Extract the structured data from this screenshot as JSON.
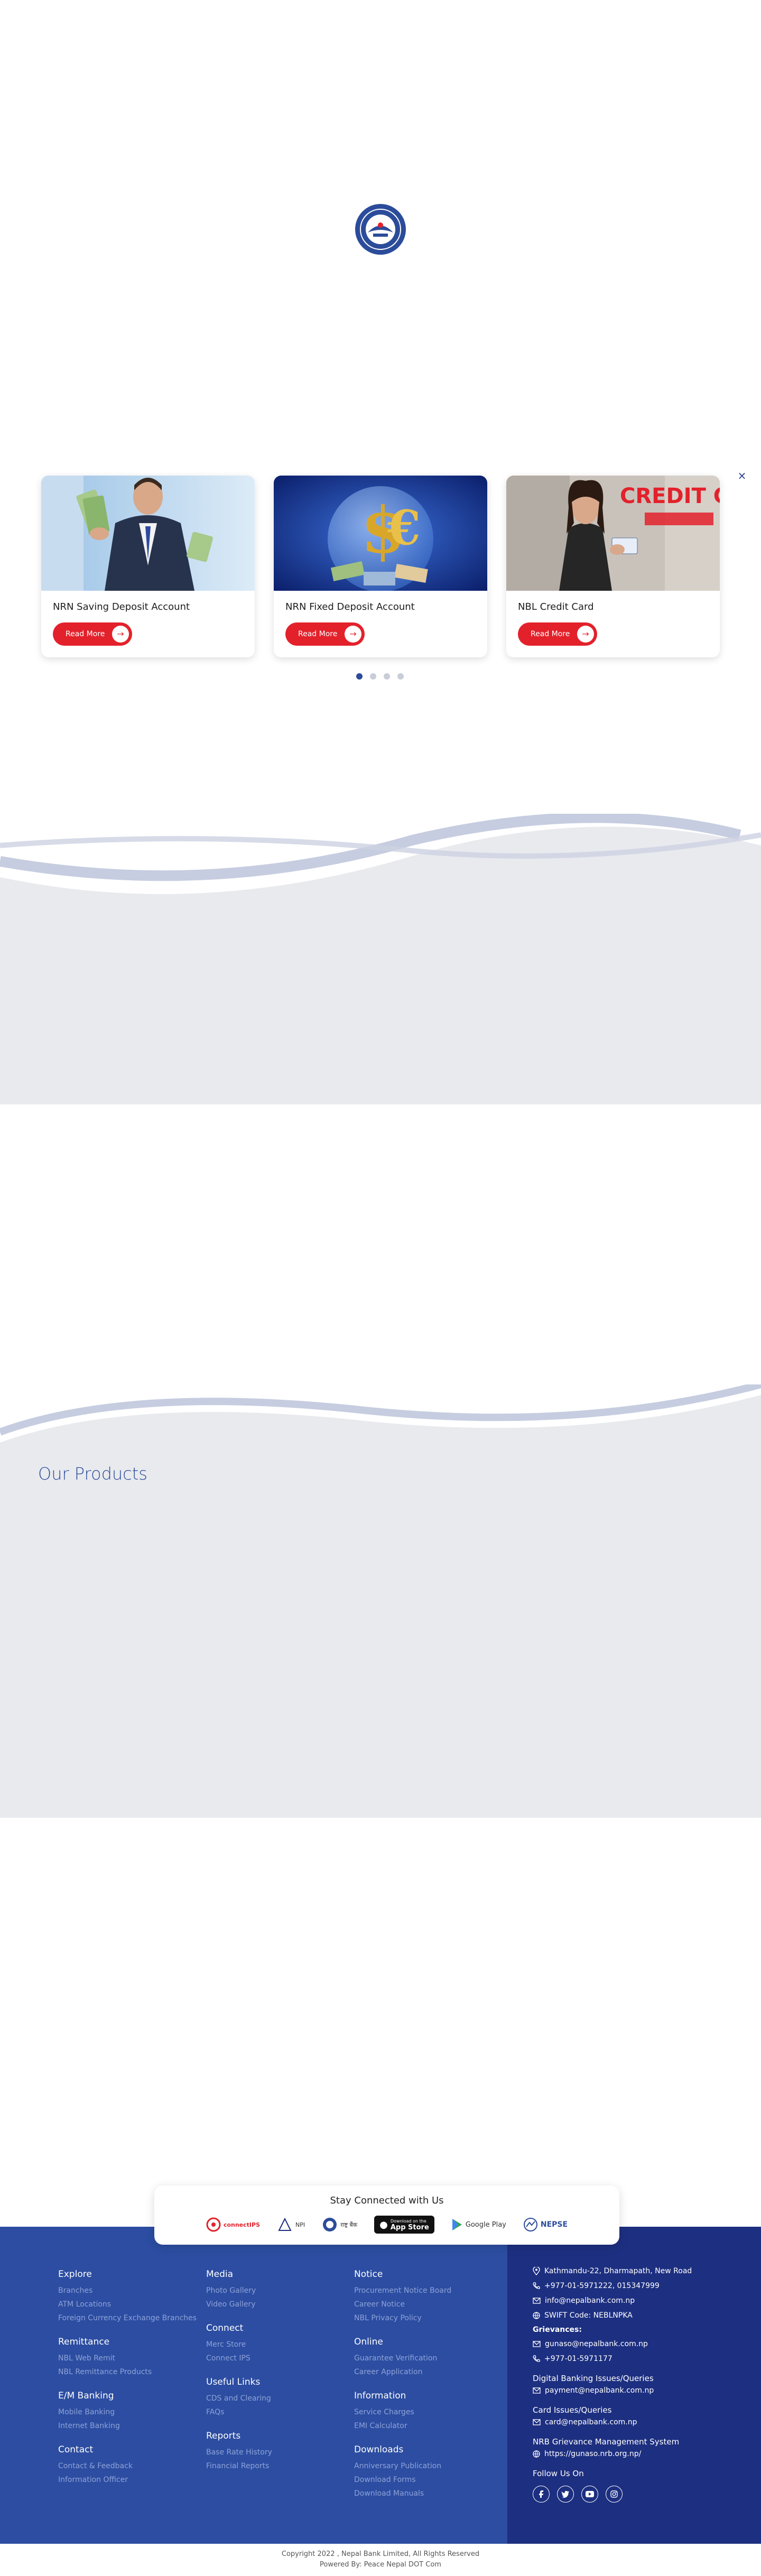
{
  "loader": {
    "logo_icon": "nepal-bank-emblem-icon"
  },
  "slider": {
    "close_glyph": "×",
    "cards": [
      {
        "title": "NRN Saving Deposit Account",
        "button": "Read More",
        "image_icon": "businessman-with-cash-image"
      },
      {
        "title": "NRN Fixed Deposit Account",
        "button": "Read More",
        "image_icon": "dollar-globe-image"
      },
      {
        "title": "NBL Credit Card",
        "button": "Read More",
        "image_icon": "credit-card-woman-image",
        "banner_text": "CREDIT CARD"
      }
    ],
    "dots": 4,
    "active_dot": 0
  },
  "products": {
    "heading": "Our Products"
  },
  "stay_connected": {
    "heading": "Stay Connected with Us",
    "logos": [
      {
        "name": "connectIPS",
        "icon": "connectips-logo"
      },
      {
        "name": "NPI",
        "icon": "npi-logo"
      },
      {
        "name": "राष्ट्र बैंक",
        "icon": "nepal-rastra-bank-logo"
      },
      {
        "name": "App Store",
        "icon": "apple-icon",
        "pre": "Download on the"
      },
      {
        "name": "Google Play",
        "icon": "google-play-icon"
      },
      {
        "name": "NEPSE",
        "icon": "nepse-logo"
      }
    ]
  },
  "footer": {
    "col1": [
      {
        "heading": "Explore",
        "links": [
          "Branches",
          "ATM Locations",
          "Foreign Currency Exchange Branches"
        ]
      },
      {
        "heading": "Remittance",
        "links": [
          "NBL Web Remit",
          "NBL Remittance Products"
        ]
      },
      {
        "heading": "E/M Banking",
        "links": [
          "Mobile Banking",
          "Internet Banking"
        ]
      },
      {
        "heading": "Contact",
        "links": [
          "Contact & Feedback",
          "Information Officer"
        ]
      }
    ],
    "col2": [
      {
        "heading": "Media",
        "links": [
          "Photo Gallery",
          "Video Gallery"
        ]
      },
      {
        "heading": "Connect",
        "links": [
          "Merc Store",
          "Connect IPS"
        ]
      },
      {
        "heading": "Useful Links",
        "links": [
          "CDS and Clearing",
          "FAQs"
        ]
      },
      {
        "heading": "Reports",
        "links": [
          "Base Rate History",
          "Financial Reports"
        ]
      }
    ],
    "col3": [
      {
        "heading": "Notice",
        "links": [
          "Procurement Notice Board",
          "Career Notice",
          "NBL Privacy Policy"
        ]
      },
      {
        "heading": "Online",
        "links": [
          "Guarantee Verification",
          "Career Application"
        ]
      },
      {
        "heading": "Information",
        "links": [
          "Service Charges",
          "EMI Calculator"
        ]
      },
      {
        "heading": "Downloads",
        "links": [
          "Anniversary Publication",
          "Download Forms",
          "Download Manuals"
        ]
      }
    ],
    "contact": {
      "address": "Kathmandu-22, Dharmapath, New Road",
      "phone": "+977-01-5971222, 015347999",
      "email": "info@nepalbank.com.np",
      "swift": "SWIFT Code: NEBLNPKA",
      "grievances_label": "Grievances:",
      "grievance_email": "gunaso@nepalbank.com.np",
      "grievance_phone": "+977-01-5971177",
      "digital_label": "Digital Banking Issues/Queries",
      "digital_email": "payment@nepalbank.com.np",
      "card_label": "Card Issues/Queries",
      "card_email": "card@nepalbank.com.np",
      "nrb_label": "NRB Grievance Management System",
      "nrb_url": "https://gunaso.nrb.org.np/",
      "follow_label": "Follow Us On",
      "social": [
        "facebook-icon",
        "twitter-icon",
        "youtube-icon",
        "instagram-icon"
      ]
    }
  },
  "copyright": {
    "line1": "Copyright 2022 , Nepal Bank Limited, All Rights Reserved",
    "line2": "Powered By: Peace Nepal DOT Com"
  },
  "colors": {
    "brand_blue": "#2c4da1",
    "brand_dark_blue": "#1d2f80",
    "accent_red": "#e3212b",
    "grey_bg": "#e9eaee"
  }
}
